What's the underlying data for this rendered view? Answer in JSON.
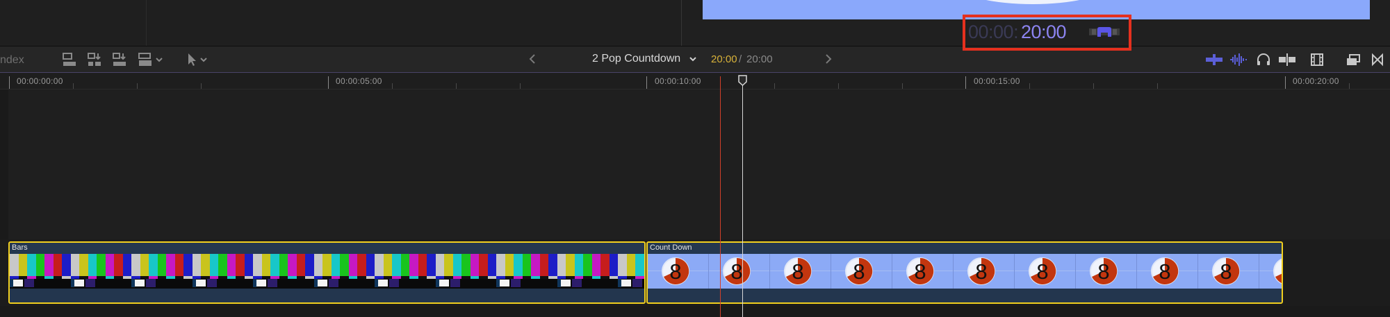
{
  "viewer": {
    "timecode_dim": "00:00:",
    "timecode_lit": "20:00"
  },
  "toolbar": {
    "index_label": "ndex",
    "project_title": "2 Pop Countdown",
    "duration_current": "20:00",
    "duration_separator": "/",
    "duration_total": "20:00",
    "icons_left": [
      "append-clip-icon",
      "insert-clip-icon",
      "overwrite-clip-icon",
      "connect-clip-icon",
      "select-tool-icon"
    ],
    "icons_right": [
      "video-waveform-icon",
      "audio-waveform-icon",
      "headphones-icon",
      "skimming-icon",
      "clip-appearance-icon",
      "timeline-index-icon",
      "close-timeline-icon"
    ]
  },
  "ruler": {
    "labels": [
      "00:00:00:00",
      "00:00:05:00",
      "00:00:10:00",
      "00:00:15:00",
      "00:00:20:00"
    ]
  },
  "clips": {
    "bars_name": "Bars",
    "countdown_name": "Count Down",
    "countdown_digit": "8"
  },
  "colors": {
    "selection_outline": "#f2d01e",
    "timecode_highlight": "#e5301e",
    "timecode_accent": "#8c84f0",
    "duration_accent": "#d8b23a",
    "playhead_skimmer": "#d2402a"
  }
}
